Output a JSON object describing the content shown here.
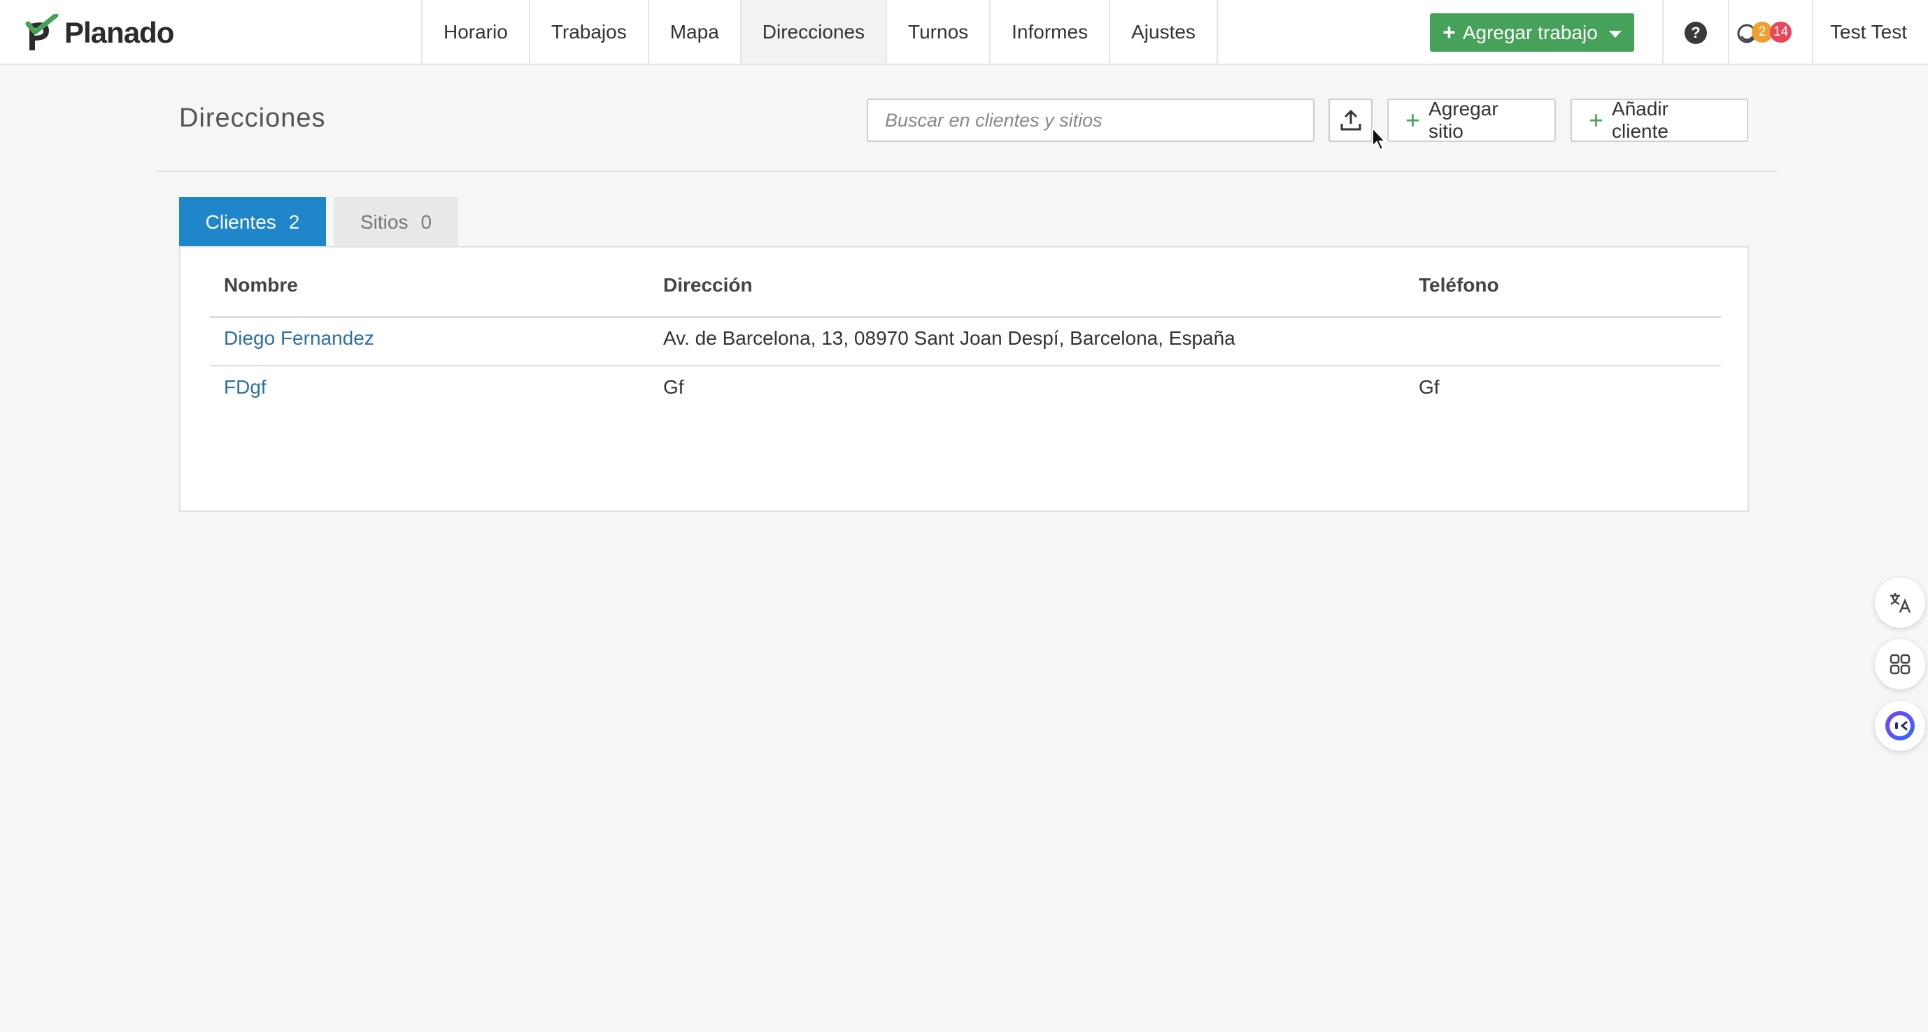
{
  "app": {
    "logo_text": "Planado",
    "brand_color": "#47a259",
    "accent_color": "#1e86c9"
  },
  "nav": {
    "items": [
      {
        "label": "Horario",
        "active": false
      },
      {
        "label": "Trabajos",
        "active": false
      },
      {
        "label": "Mapa",
        "active": false
      },
      {
        "label": "Direcciones",
        "active": true
      },
      {
        "label": "Turnos",
        "active": false
      },
      {
        "label": "Informes",
        "active": false
      },
      {
        "label": "Ajustes",
        "active": false
      }
    ],
    "add_job_label": "Agregar trabajo",
    "help_label": "?",
    "notifications": {
      "warning_count": "2",
      "alert_count": "14"
    },
    "user_name": "Test Test"
  },
  "page": {
    "title": "Direcciones",
    "search_placeholder": "Buscar en clientes y sitios",
    "add_site_label": "Agregar sitio",
    "add_client_label": "Añadir cliente"
  },
  "tabs": [
    {
      "label": "Clientes",
      "count": "2",
      "active": true
    },
    {
      "label": "Sitios",
      "count": "0",
      "active": false
    }
  ],
  "table": {
    "columns": [
      "Nombre",
      "Dirección",
      "Teléfono"
    ],
    "rows": [
      {
        "name": "Diego Fernandez",
        "address": "Av. de Barcelona, 13, 08970 Sant Joan Despí, Barcelona, España",
        "phone": ""
      },
      {
        "name": "FDgf",
        "address": "Gf",
        "phone": "Gf"
      }
    ]
  },
  "side_buttons": [
    "translate-icon",
    "apps-grid-icon",
    "assistant-icon"
  ]
}
